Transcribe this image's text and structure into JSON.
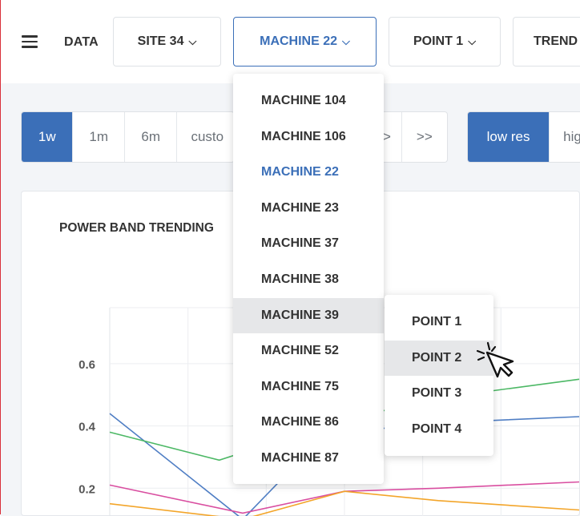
{
  "topbar": {
    "data_label": "DATA",
    "site_label": "SITE 34",
    "machine_label": "MACHINE 22",
    "point_label": "POINT 1",
    "trend_label": "TREND"
  },
  "time_ranges": [
    "1w",
    "1m",
    "6m",
    "custo"
  ],
  "nav": {
    "next": ">",
    "last": ">>"
  },
  "resolution": {
    "low": "low res",
    "high": "hig"
  },
  "chart": {
    "title": "POWER BAND TRENDING"
  },
  "machine_menu": [
    "MACHINE 104",
    "MACHINE 106",
    "MACHINE 22",
    "MACHINE 23",
    "MACHINE 37",
    "MACHINE 38",
    "MACHINE 39",
    "MACHINE 52",
    "MACHINE 75",
    "MACHINE 86",
    "MACHINE 87"
  ],
  "machine_menu_selected": "MACHINE 22",
  "machine_menu_hovered": "MACHINE 39",
  "point_menu": [
    "POINT 1",
    "POINT 2",
    "POINT 3",
    "POINT 4"
  ],
  "point_menu_hovered": "POINT 2",
  "colors": {
    "accent": "#3b6fb8",
    "series_blue": "#4f7ec4",
    "series_green": "#4cb865",
    "series_magenta": "#d94ea0",
    "series_orange": "#f3a52a"
  },
  "chart_data": {
    "type": "line",
    "title": "POWER BAND TRENDING",
    "xlabel": "",
    "ylabel": "",
    "yticks": [
      0.2,
      0.4,
      0.6
    ],
    "ylim": [
      0.0,
      0.78
    ],
    "xlim": [
      0,
      6
    ],
    "grid": true,
    "series": [
      {
        "color": "#4f7ec4",
        "points": [
          [
            0,
            0.44
          ],
          [
            1.7,
            0.1
          ],
          [
            2.2,
            0.23
          ],
          [
            3.0,
            0.38
          ],
          [
            4.2,
            0.41
          ],
          [
            6.0,
            0.43
          ]
        ]
      },
      {
        "color": "#4cb865",
        "points": [
          [
            0,
            0.38
          ],
          [
            1.4,
            0.29
          ],
          [
            3.0,
            0.42
          ],
          [
            4.2,
            0.49
          ],
          [
            6.0,
            0.55
          ]
        ]
      },
      {
        "color": "#d94ea0",
        "points": [
          [
            0,
            0.21
          ],
          [
            1.7,
            0.12
          ],
          [
            3.0,
            0.19
          ],
          [
            4.2,
            0.2
          ],
          [
            6.0,
            0.22
          ]
        ]
      },
      {
        "color": "#f3a52a",
        "points": [
          [
            0,
            0.15
          ],
          [
            1.7,
            0.1
          ],
          [
            3.0,
            0.19
          ],
          [
            4.2,
            0.16
          ],
          [
            6.0,
            0.13
          ]
        ]
      }
    ]
  }
}
